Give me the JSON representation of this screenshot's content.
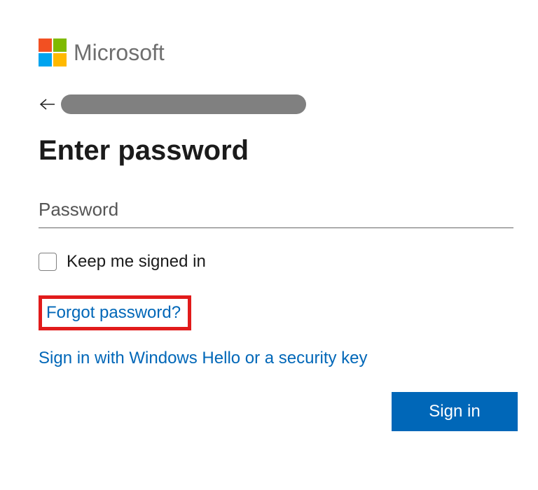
{
  "brand": "Microsoft",
  "title": "Enter password",
  "password_placeholder": "Password",
  "keep_signed_in_label": "Keep me signed in",
  "forgot_password_label": "Forgot password?",
  "windows_hello_label": "Sign in with Windows Hello or a security key",
  "signin_button_label": "Sign in",
  "colors": {
    "accent": "#0067b8",
    "highlight_border": "#e11b1b"
  }
}
